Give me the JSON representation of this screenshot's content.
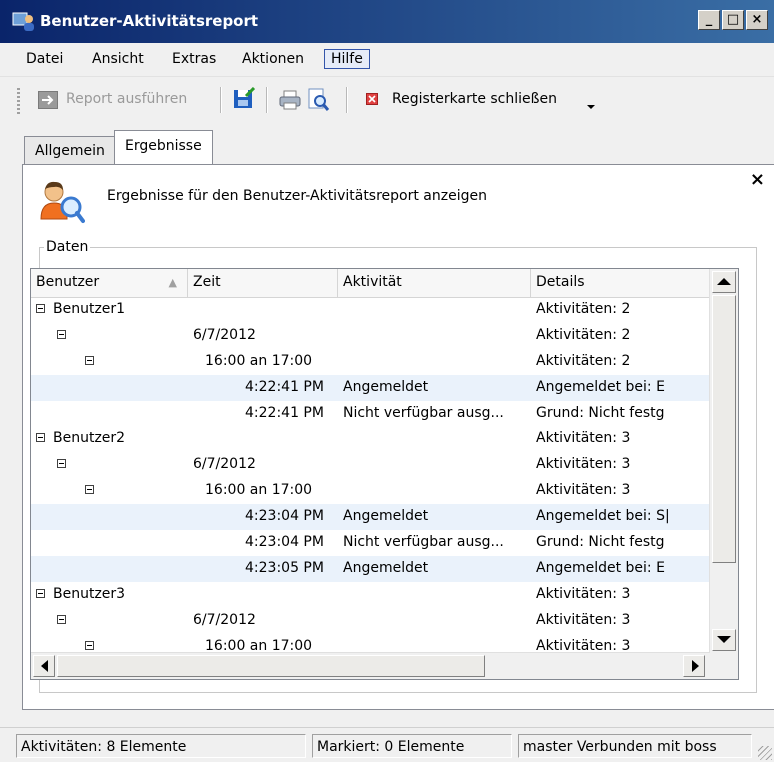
{
  "window": {
    "title": "Benutzer-Aktivitätsreport",
    "controls": {
      "minimize": "_",
      "maximize": "□",
      "close": "×"
    }
  },
  "menu": {
    "items": [
      {
        "label": "Datei"
      },
      {
        "label": "Ansicht"
      },
      {
        "label": "Extras"
      },
      {
        "label": "Aktionen"
      },
      {
        "label": "Hilfe",
        "active": true
      }
    ]
  },
  "toolbar": {
    "run_report": "Report ausführen",
    "close_tab": "Registerkarte schließen",
    "icons": [
      "run-icon",
      "save-icon",
      "print-icon",
      "print-preview-icon",
      "close-tab-icon",
      "overflow-chevron-icon"
    ]
  },
  "tabs": [
    {
      "label": "Allgemein",
      "selected": false
    },
    {
      "label": "Ergebnisse",
      "selected": true
    }
  ],
  "panel": {
    "close_glyph": "×",
    "description": "Ergebnisse für den Benutzer-Aktivitätsreport anzeigen",
    "group_label": "Daten"
  },
  "grid": {
    "columns": [
      {
        "label": "Benutzer",
        "sorted": "asc"
      },
      {
        "label": "Zeit"
      },
      {
        "label": "Aktivität"
      },
      {
        "label": "Details"
      }
    ],
    "rows": [
      {
        "level": 0,
        "user": "Benutzer1",
        "time": "",
        "activity": "",
        "details": "Aktivitäten: 2"
      },
      {
        "level": 1,
        "user": "",
        "time": "6/7/2012",
        "activity": "",
        "details": "Aktivitäten: 2"
      },
      {
        "level": 2,
        "user": "",
        "time": "16:00 an 17:00",
        "activity": "",
        "details": "Aktivitäten: 2"
      },
      {
        "level": 3,
        "user": "",
        "time": "4:22:41 PM",
        "activity": "Angemeldet",
        "details": "Angemeldet bei: E",
        "alt": true
      },
      {
        "level": 3,
        "user": "",
        "time": "4:22:41 PM",
        "activity": "Nicht verfügbar ausg...",
        "details": "Grund: Nicht festg"
      },
      {
        "level": 0,
        "user": "Benutzer2",
        "time": "",
        "activity": "",
        "details": "Aktivitäten: 3"
      },
      {
        "level": 1,
        "user": "",
        "time": "6/7/2012",
        "activity": "",
        "details": "Aktivitäten: 3"
      },
      {
        "level": 2,
        "user": "",
        "time": "16:00 an 17:00",
        "activity": "",
        "details": "Aktivitäten: 3"
      },
      {
        "level": 3,
        "user": "",
        "time": "4:23:04 PM",
        "activity": "Angemeldet",
        "details": "Angemeldet bei: S|",
        "alt": true
      },
      {
        "level": 3,
        "user": "",
        "time": "4:23:04 PM",
        "activity": "Nicht verfügbar ausg...",
        "details": "Grund: Nicht festg"
      },
      {
        "level": 3,
        "user": "",
        "time": "4:23:05 PM",
        "activity": "Angemeldet",
        "details": "Angemeldet bei: E",
        "alt": true
      },
      {
        "level": 0,
        "user": "Benutzer3",
        "time": "",
        "activity": "",
        "details": "Aktivitäten: 3"
      },
      {
        "level": 1,
        "user": "",
        "time": "6/7/2012",
        "activity": "",
        "details": "Aktivitäten: 3"
      },
      {
        "level": 2,
        "user": "",
        "time": "16:00 an 17:00",
        "activity": "",
        "details": "Aktivitäten: 3"
      }
    ]
  },
  "status": {
    "activities": "Aktivitäten: 8 Elemente",
    "selected": "Markiert: 0 Elemente",
    "connection": "master Verbunden mit boss"
  },
  "colors": {
    "title_gradient_start": "#0a246a",
    "title_gradient_end": "#3a6ea5",
    "row_alt": "#eaf2fb"
  }
}
